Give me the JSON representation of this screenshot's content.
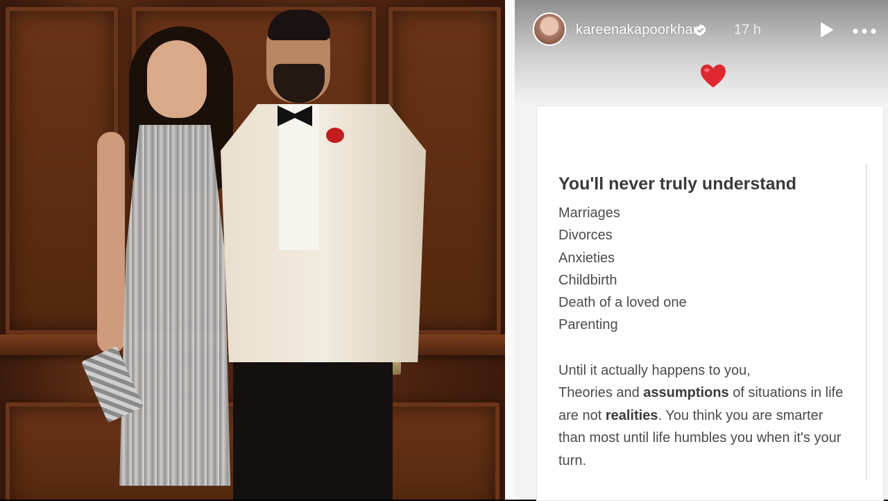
{
  "story": {
    "username": "kareenakapoorkhan",
    "verified": true,
    "time_ago": "17 h",
    "sticker": "heart-emoji",
    "colors": {
      "heart": "#e0282f",
      "verified": "#3897f0",
      "card_bg": "#ffffff",
      "text": "#4a4a4a"
    }
  },
  "card": {
    "headline": "You'll never truly understand",
    "items": [
      "Marriages",
      "Divorces",
      "Anxieties",
      "Childbirth",
      "Death of a loved one",
      "Parenting"
    ],
    "paragraph": {
      "line1": "Until it actually happens to you,",
      "p2_a": "Theories and ",
      "p2_b": "assumptions",
      "p2_c": " of situations in life are not ",
      "p2_d": "realities",
      "p2_e": ". You think you are smarter than most until life humbles you when it's your turn."
    }
  },
  "icons": {
    "play": "play-icon",
    "more": "more-options-icon",
    "verified": "verified-badge-icon"
  }
}
